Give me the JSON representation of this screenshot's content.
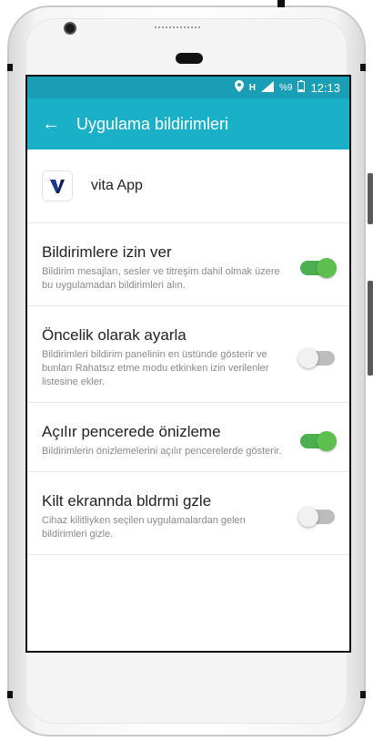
{
  "status_bar": {
    "time": "12:13",
    "battery_percent": "%9",
    "icons": [
      "location-icon",
      "network-h-icon",
      "signal-icon",
      "battery-icon"
    ]
  },
  "app_bar": {
    "title": "Uygulama bildirimleri",
    "back_icon": "back-arrow-icon"
  },
  "app": {
    "name": "vita App",
    "icon": "vita-logo-icon"
  },
  "settings": [
    {
      "title": "Bildirimlere izin ver",
      "description": "Bildirim mesajları, sesler ve titreşim dahil olmak üzere bu uygulamadan bildirimleri alın.",
      "enabled": true
    },
    {
      "title": "Öncelik olarak ayarla",
      "description": "Bildirimleri bildirim panelinin en üstünde gösterir ve bunları Rahatsız etme modu etkinken izin verilenler listesine ekler.",
      "enabled": false
    },
    {
      "title": "Açılır pencerede önizleme",
      "description": "Bildirimlerin önizlemelerini açılır pencerelerde gösterir.",
      "enabled": true
    },
    {
      "title": "Kilt ekrannda bldrmi gzle",
      "description": "Cihaz kilitliyken seçilen uygulamalardan gelen bildirimleri gizle.",
      "enabled": false
    }
  ],
  "colors": {
    "status_bar": "#1a9eb5",
    "app_bar": "#1ab0c8",
    "toggle_on": "#4caf50",
    "toggle_off": "#bdbdbd"
  }
}
